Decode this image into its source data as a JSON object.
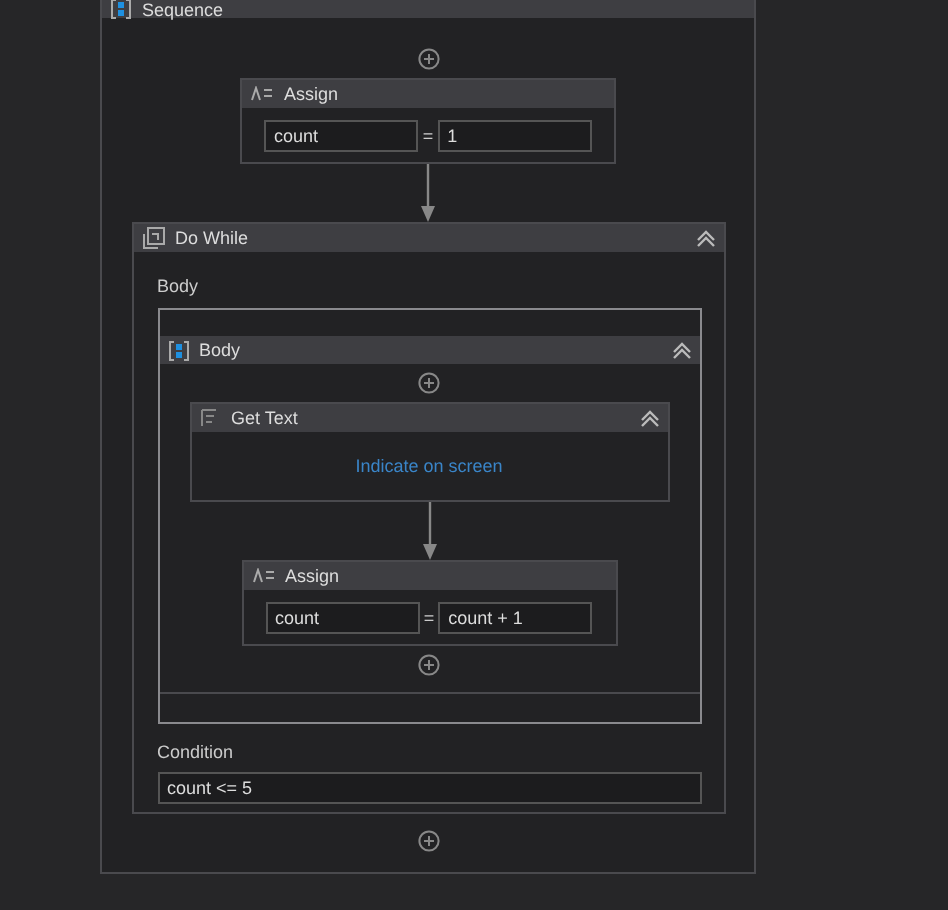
{
  "sequence": {
    "title": "Sequence",
    "activities": [
      {
        "kind": "assign",
        "title": "Assign",
        "to": "count",
        "operator": "=",
        "value": "1"
      },
      {
        "kind": "do_while",
        "title": "Do While",
        "body_label": "Body",
        "body": {
          "title": "Body",
          "activities": [
            {
              "kind": "get_text",
              "title": "Get Text",
              "target": "Indicate on screen"
            },
            {
              "kind": "assign",
              "title": "Assign",
              "to": "count",
              "operator": "=",
              "value": "count + 1"
            }
          ]
        },
        "condition_label": "Condition",
        "condition": "count <= 5"
      }
    ]
  }
}
